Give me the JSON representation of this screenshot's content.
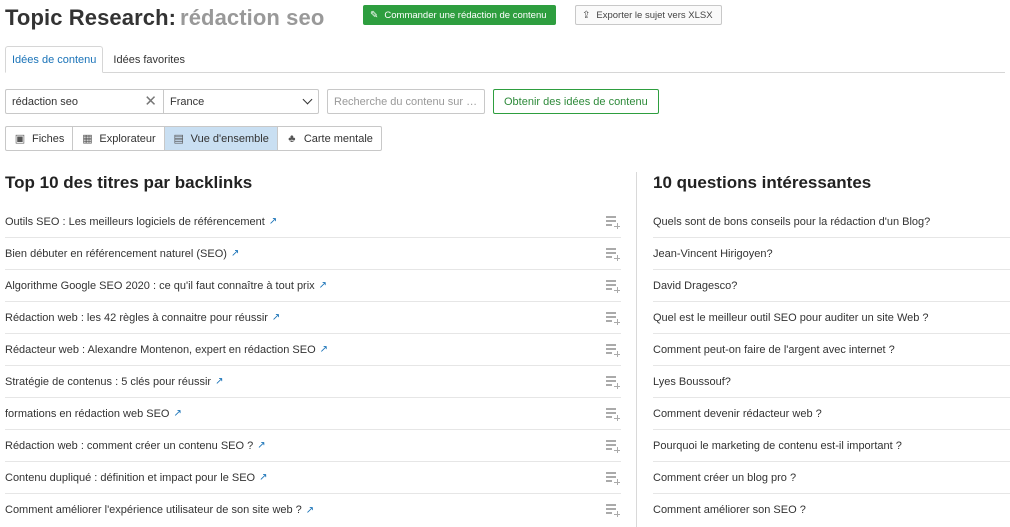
{
  "header": {
    "title": "Topic Research:",
    "keyword": "rédaction seo",
    "order_button": "Commander une rédaction de contenu",
    "export_button": "Exporter le sujet vers XLSX"
  },
  "tabs": [
    {
      "label": "Idées de contenu",
      "active": true
    },
    {
      "label": "Idées favorites",
      "active": false
    }
  ],
  "search": {
    "keyword_value": "rédaction seo",
    "database_value": "France",
    "content_placeholder": "Recherche du contenu sur …",
    "submit_label": "Obtenir des idées de contenu"
  },
  "views": [
    {
      "label": "Fiches",
      "icon": "cards-icon",
      "active": false
    },
    {
      "label": "Explorateur",
      "icon": "table-icon",
      "active": false
    },
    {
      "label": "Vue d'ensemble",
      "icon": "overview-icon",
      "active": true
    },
    {
      "label": "Carte mentale",
      "icon": "mindmap-icon",
      "active": false
    }
  ],
  "headlines": {
    "title": "Top 10 des titres par backlinks",
    "items": [
      "Outils SEO : Les meilleurs logiciels de référencement",
      "Bien débuter en référencement naturel (SEO)",
      "Algorithme Google SEO 2020 : ce qu'il faut connaître à tout prix",
      "Rédaction web : les 42 règles à connaitre pour réussir",
      "Rédacteur web : Alexandre Montenon, expert en rédaction SEO",
      "Stratégie de contenus : 5 clés pour réussir",
      "formations en rédaction web SEO",
      "Rédaction web : comment créer un contenu SEO ?",
      "Contenu dupliqué : définition et impact pour le SEO",
      "Comment améliorer l'expérience utilisateur de son site web ?"
    ]
  },
  "questions": {
    "title": "10 questions intéressantes",
    "items": [
      "Quels sont de bons conseils pour la rédaction d'un Blog?",
      "Jean-Vincent Hirigoyen?",
      "David Dragesco?",
      "Quel est le meilleur outil SEO pour auditer un site Web ?",
      "Comment peut-on faire de l'argent avec internet ?",
      "Lyes Boussouf?",
      "Comment devenir rédacteur web ?",
      "Pourquoi le marketing de contenu est-il important ?",
      "Comment créer un blog pro ?",
      "Comment améliorer son SEO ?"
    ]
  },
  "colors": {
    "accent_green": "#2e9e3f",
    "link_blue": "#1a73b8",
    "active_view": "#c9dff2"
  }
}
